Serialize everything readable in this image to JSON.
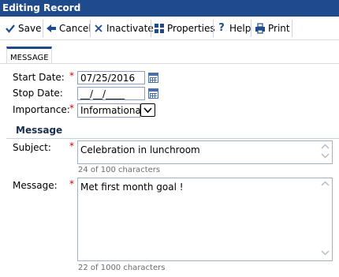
{
  "window": {
    "title": "Editing Record"
  },
  "toolbar": {
    "save_label": "Save",
    "cancel_label": "Cancel",
    "inactivate_label": "Inactivate",
    "properties_label": "Properties",
    "help_label": "Help",
    "print_label": "Print"
  },
  "tabs": [
    {
      "label": "MESSAGE"
    }
  ],
  "form": {
    "start_date": {
      "label": "Start Date:",
      "value": "07/25/2016",
      "required_mark": "*"
    },
    "stop_date": {
      "label": "Stop Date:",
      "value": "__/__/____"
    },
    "importance": {
      "label": "Importance:",
      "value": "Informational",
      "required_mark": "*"
    },
    "section_title": "Message",
    "subject": {
      "label": "Subject:",
      "value": "Celebration in lunchroom",
      "counter": "24 of 100 characters",
      "required_mark": "*"
    },
    "message": {
      "label": "Message:",
      "value": "Met first month goal !",
      "counter": "22 of 1000 characters",
      "required_mark": "*"
    }
  },
  "colors": {
    "title_bar": "#1f4b8c",
    "required": "#d40000",
    "toolbar_icon": "#1f4b8c"
  }
}
